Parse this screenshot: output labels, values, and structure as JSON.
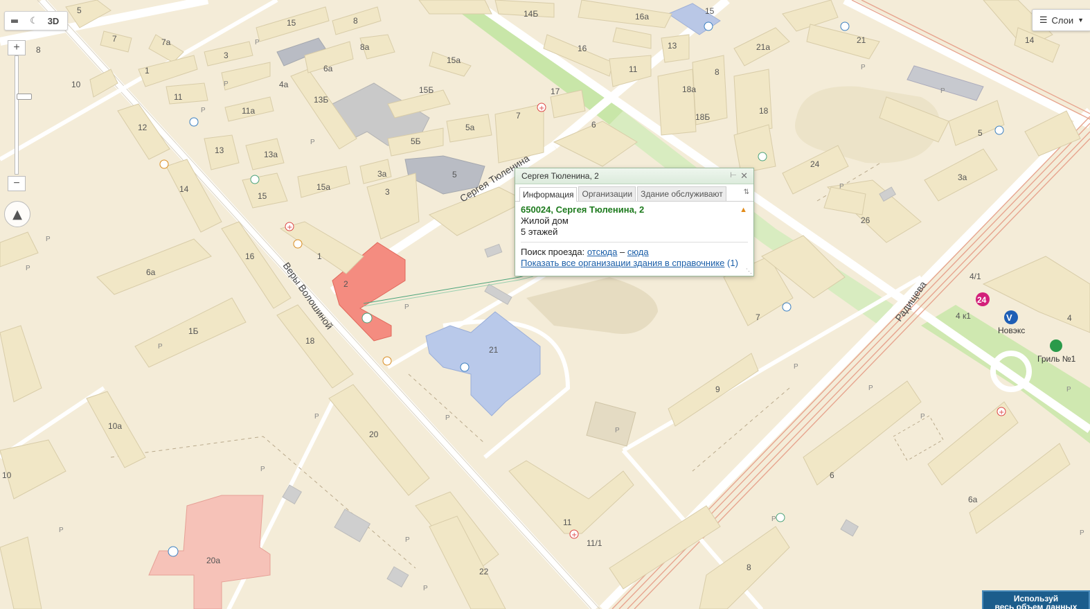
{
  "toolbar": {
    "ruler": "ruler-icon",
    "night": "moon-icon",
    "mode_3d": "3D"
  },
  "zoom": {
    "plus": "+",
    "minus": "−",
    "level": 0.34
  },
  "layers": {
    "label": "Слои"
  },
  "streets": {
    "tyulenina": "Сергея Тюленина",
    "voloshinoy": "Веры Волошиной",
    "radishcheva": "Радищева"
  },
  "popup": {
    "title": "Сергея Тюленина, 2",
    "tabs": [
      "Информация",
      "Организации",
      "Здание обслуживают"
    ],
    "address": "650024, Сергея Тюленина, 2",
    "type": "Жилой дом",
    "floors": "5 этажей",
    "route_label": "Поиск проезда:",
    "route_from": "отсюда",
    "route_dash": "–",
    "route_to": "сюда",
    "orgs_link": "Показать все организации здания в справочнике",
    "orgs_count": "(1)"
  },
  "pois": {
    "novaks": "Новэкс",
    "grill": "Гриль №1",
    "badge_24": "24"
  },
  "promo": {
    "line1": "Используй",
    "line2": "весь объем данных"
  },
  "building_labels": {
    "b5": "5",
    "b15": "15",
    "b14b": "14Б",
    "b16a": "16а",
    "b15top": "15",
    "b21top": "21",
    "b14": "14",
    "b8tl": "8",
    "b7": "7",
    "b7a": "7а",
    "b3": "3",
    "b1": "1",
    "b10": "10",
    "b11": "11",
    "b12": "12",
    "b13": "13",
    "b14l": "14",
    "b15l": "15",
    "b16l": "16",
    "b6a": "6а",
    "b1b": "1Б",
    "b18": "18",
    "b10a": "10а",
    "b10b": "10",
    "b20": "20",
    "b20a": "20а",
    "b22": "22",
    "b8a": "8а",
    "b6a2": "6а",
    "b4a": "4а",
    "b13b": "13Б",
    "b11a": "11а",
    "b13a": "13а",
    "b15a": "15а",
    "b15b": "15Б",
    "b5a": "5а",
    "b5b": "5Б",
    "b3a": "3а",
    "b3m": "3",
    "b5m": "5",
    "b1m": "1",
    "b2": "2",
    "b17": "17",
    "b7m": "7",
    "b6": "6",
    "b21": "21",
    "b16": "16",
    "b13m": "13",
    "b11m": "11",
    "b8m": "8",
    "b18a": "18а",
    "b18b": "18Б",
    "b18m": "18",
    "b21a": "21а",
    "b21r": "21",
    "b24": "24",
    "b26": "26",
    "b3ar": "3а",
    "b5r": "5",
    "b7r": "7",
    "b9": "9",
    "b11b": "11",
    "b11_1": "11/1",
    "b8b": "8",
    "b6r": "6",
    "b6ar": "6а",
    "b4_1": "4/1",
    "b4k1": "4 к1",
    "b4": "4"
  }
}
